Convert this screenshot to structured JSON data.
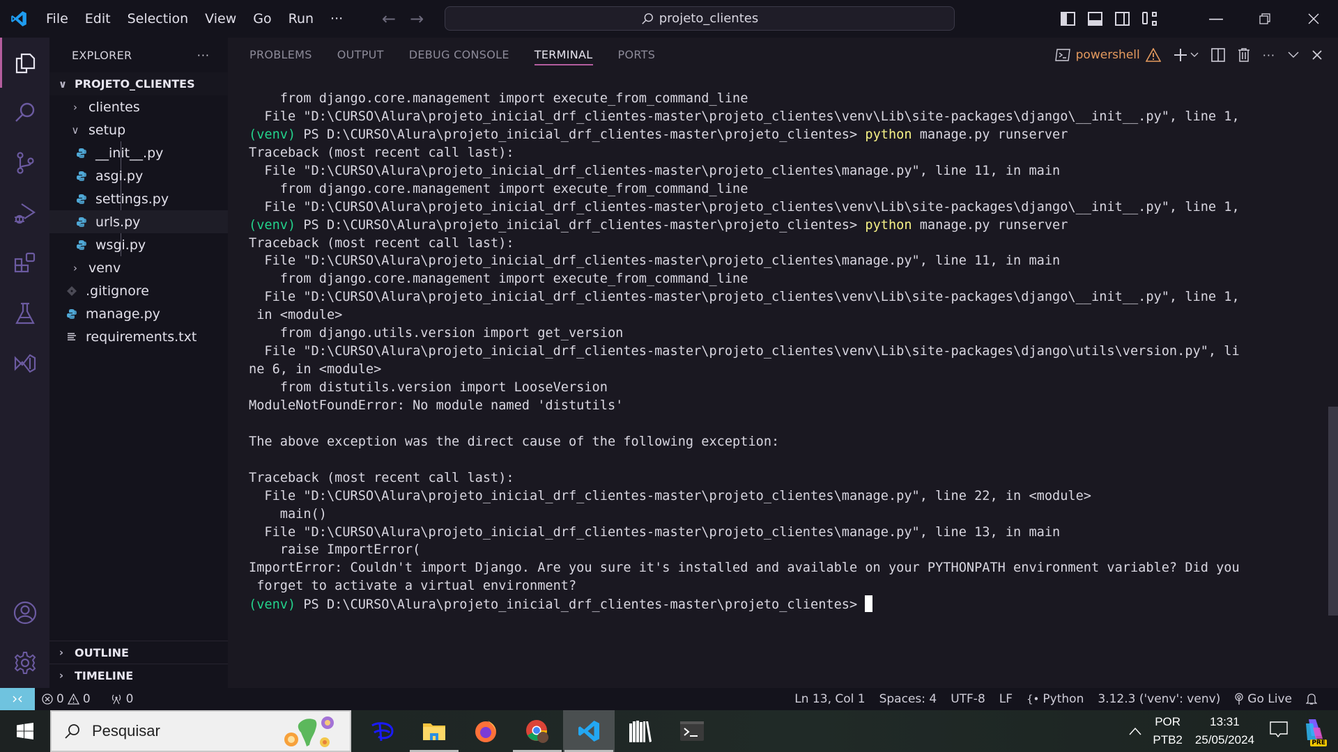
{
  "titlebar": {
    "menu": [
      "File",
      "Edit",
      "Selection",
      "View",
      "Go",
      "Run",
      "···"
    ],
    "search_text": "projeto_clientes"
  },
  "sidebar": {
    "title": "EXPLORER",
    "more": "···",
    "root": "PROJETO_CLIENTES",
    "items": [
      {
        "label": "clientes",
        "type": "folder",
        "expanded": false,
        "depth": 1
      },
      {
        "label": "setup",
        "type": "folder",
        "expanded": true,
        "depth": 1
      },
      {
        "label": "__init__.py",
        "type": "python",
        "depth": 2
      },
      {
        "label": "asgi.py",
        "type": "python",
        "depth": 2
      },
      {
        "label": "settings.py",
        "type": "python",
        "depth": 2
      },
      {
        "label": "urls.py",
        "type": "python",
        "depth": 2,
        "selected": true
      },
      {
        "label": "wsgi.py",
        "type": "python",
        "depth": 2
      },
      {
        "label": "venv",
        "type": "folder",
        "expanded": false,
        "depth": 1
      },
      {
        "label": ".gitignore",
        "type": "git",
        "depth": 1
      },
      {
        "label": "manage.py",
        "type": "python",
        "depth": 1
      },
      {
        "label": "requirements.txt",
        "type": "text",
        "depth": 1
      }
    ],
    "outline": "OUTLINE",
    "timeline": "TIMELINE"
  },
  "panel": {
    "tabs": [
      "PROBLEMS",
      "OUTPUT",
      "DEBUG CONSOLE",
      "TERMINAL",
      "PORTS"
    ],
    "active_tab": "TERMINAL",
    "shell": "powershell"
  },
  "terminal": {
    "prompt_env": "(venv)",
    "prompt_path": " PS D:\\CURSO\\Alura\\projeto_inicial_drf_clientes-master\\projeto_clientes> ",
    "cmd_bin": "python",
    "cmd_args": " manage.py runserver",
    "lines": [
      {
        "t": "    from django.core.management import execute_from_command_line"
      },
      {
        "t": "  File \"D:\\CURSO\\Alura\\projeto_inicial_drf_clientes-master\\projeto_clientes\\venv\\Lib\\site-packages\\django\\__init__.py\", line 1,"
      },
      {
        "prompt": true,
        "cmd": true
      },
      {
        "t": "Traceback (most recent call last):"
      },
      {
        "t": "  File \"D:\\CURSO\\Alura\\projeto_inicial_drf_clientes-master\\projeto_clientes\\manage.py\", line 11, in main"
      },
      {
        "t": "    from django.core.management import execute_from_command_line"
      },
      {
        "t": "  File \"D:\\CURSO\\Alura\\projeto_inicial_drf_clientes-master\\projeto_clientes\\venv\\Lib\\site-packages\\django\\__init__.py\", line 1,"
      },
      {
        "prompt": true,
        "cmd": true
      },
      {
        "t": "Traceback (most recent call last):"
      },
      {
        "t": "  File \"D:\\CURSO\\Alura\\projeto_inicial_drf_clientes-master\\projeto_clientes\\manage.py\", line 11, in main"
      },
      {
        "t": "    from django.core.management import execute_from_command_line"
      },
      {
        "t": "  File \"D:\\CURSO\\Alura\\projeto_inicial_drf_clientes-master\\projeto_clientes\\venv\\Lib\\site-packages\\django\\__init__.py\", line 1,"
      },
      {
        "t": " in <module>"
      },
      {
        "t": "    from django.utils.version import get_version"
      },
      {
        "t": "  File \"D:\\CURSO\\Alura\\projeto_inicial_drf_clientes-master\\projeto_clientes\\venv\\Lib\\site-packages\\django\\utils\\version.py\", li"
      },
      {
        "t": "ne 6, in <module>"
      },
      {
        "t": "    from distutils.version import LooseVersion"
      },
      {
        "t": "ModuleNotFoundError: No module named 'distutils'"
      },
      {
        "t": ""
      },
      {
        "t": "The above exception was the direct cause of the following exception:"
      },
      {
        "t": ""
      },
      {
        "t": "Traceback (most recent call last):"
      },
      {
        "t": "  File \"D:\\CURSO\\Alura\\projeto_inicial_drf_clientes-master\\projeto_clientes\\manage.py\", line 22, in <module>"
      },
      {
        "t": "    main()"
      },
      {
        "t": "  File \"D:\\CURSO\\Alura\\projeto_inicial_drf_clientes-master\\projeto_clientes\\manage.py\", line 13, in main"
      },
      {
        "t": "    raise ImportError("
      },
      {
        "t": "ImportError: Couldn't import Django. Are you sure it's installed and available on your PYTHONPATH environment variable? Did you"
      },
      {
        "t": " forget to activate a virtual environment?"
      },
      {
        "prompt": true,
        "cursor": true
      }
    ]
  },
  "statusbar": {
    "errors": "0",
    "warnings": "0",
    "ports": "0",
    "position": "Ln 13, Col 1",
    "spaces": "Spaces: 4",
    "encoding": "UTF-8",
    "eol": "LF",
    "language": "Python",
    "interpreter": "3.12.3 ('venv': venv)",
    "golive": "Go Live"
  },
  "taskbar": {
    "search_placeholder": "Pesquisar",
    "lang_top": "POR",
    "lang_bottom": "PTB2",
    "time": "13:31",
    "date": "25/05/2024",
    "copilot_badge": "PRE"
  },
  "colors": {
    "accent": "#b45d9e",
    "prompt_green": "#23d18b",
    "command_yellow": "#f5f186",
    "shell_orange": "#e49a5e",
    "remote_blue": "#6fc3df"
  }
}
